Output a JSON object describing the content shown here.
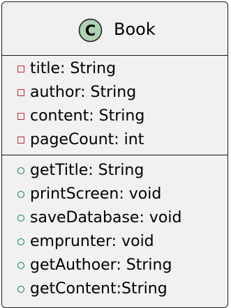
{
  "class": {
    "stereotype_letter": "C",
    "name": "Book",
    "colors": {
      "background": "#f1f1f1",
      "border": "#181818",
      "stereotype_circle": "#add1b2",
      "private_marker": "#c82930",
      "public_marker": "#038048"
    },
    "attributes": [
      {
        "visibility": "private",
        "text": "title: String"
      },
      {
        "visibility": "private",
        "text": "author: String"
      },
      {
        "visibility": "private",
        "text": "content: String"
      },
      {
        "visibility": "private",
        "text": "pageCount: int"
      }
    ],
    "methods": [
      {
        "visibility": "public",
        "text": "getTitle: String"
      },
      {
        "visibility": "public",
        "text": "printScreen: void"
      },
      {
        "visibility": "public",
        "text": "saveDatabase: void"
      },
      {
        "visibility": "public",
        "text": "emprunter: void"
      },
      {
        "visibility": "public",
        "text": "getAuthoer: String"
      },
      {
        "visibility": "public",
        "text": "getContent:String"
      }
    ]
  }
}
